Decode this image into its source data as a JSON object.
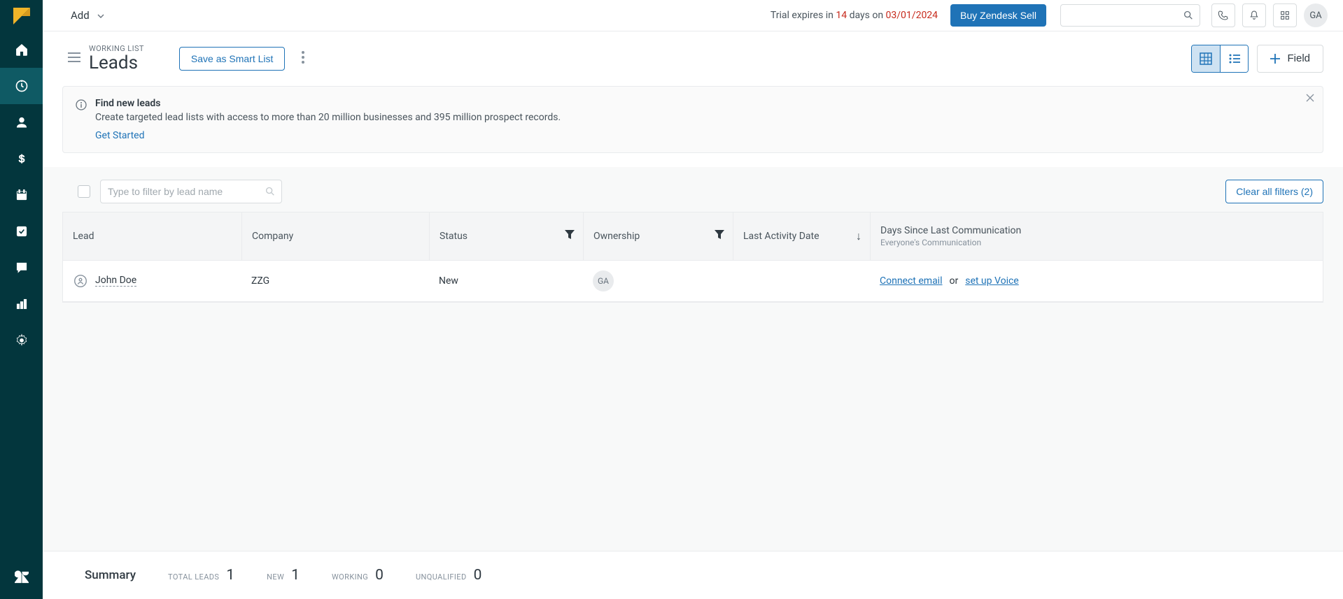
{
  "header": {
    "add_label": "Add",
    "trial_prefix": "Trial expires in ",
    "trial_days": "14",
    "trial_mid": " days on ",
    "trial_date": "03/01/2024",
    "buy_label": "Buy Zendesk Sell",
    "avatar": "GA"
  },
  "page": {
    "eyebrow": "WORKING LIST",
    "title": "Leads",
    "save_smart_label": "Save as Smart List",
    "field_btn_label": "Field"
  },
  "banner": {
    "title": "Find new leads",
    "desc": "Create targeted lead lists with access to more than 20 million businesses and 395 million prospect records.",
    "cta": "Get Started"
  },
  "filter": {
    "placeholder": "Type to filter by lead name",
    "clear_label": "Clear all filters (2)"
  },
  "table": {
    "columns": {
      "lead": "Lead",
      "company": "Company",
      "status": "Status",
      "ownership": "Ownership",
      "last_activity": "Last Activity Date",
      "comm_title": "Days Since Last Communication",
      "comm_sub": "Everyone's Communication"
    },
    "rows": [
      {
        "lead": "John Doe",
        "company": "ZZG",
        "status": "New",
        "owner": "GA",
        "last_activity": "",
        "comm_link1": "Connect email",
        "comm_sep": "or",
        "comm_link2": "set up Voice"
      }
    ]
  },
  "summary": {
    "title": "Summary",
    "stats": [
      {
        "label": "TOTAL LEADS",
        "value": "1"
      },
      {
        "label": "NEW",
        "value": "1"
      },
      {
        "label": "WORKING",
        "value": "0"
      },
      {
        "label": "UNQUALIFIED",
        "value": "0"
      }
    ]
  }
}
